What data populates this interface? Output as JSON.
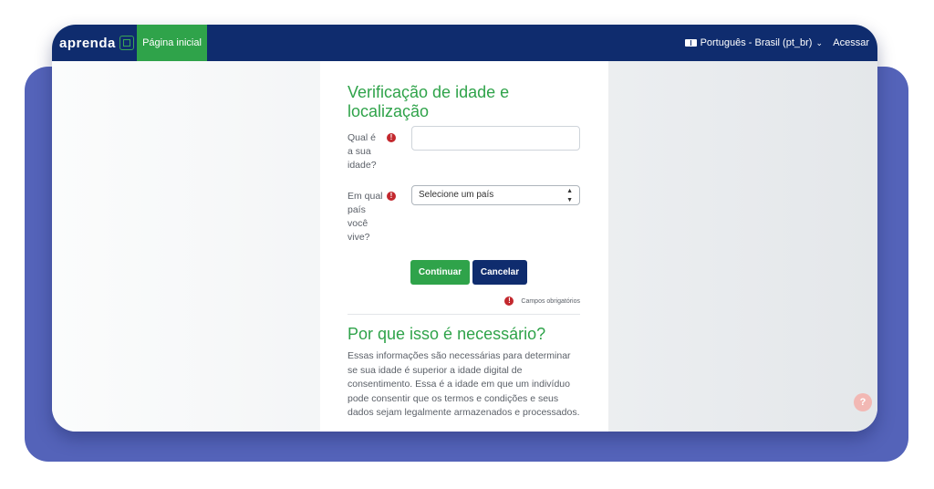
{
  "topbar": {
    "logo_text": "aprenda",
    "home_tab": "Página inicial",
    "language": "Português - Brasil (pt_br)",
    "login": "Acessar",
    "colors": {
      "bar": "#0f2c6e",
      "accent": "#2fa34a"
    }
  },
  "form": {
    "title": "Verificação de idade e localização",
    "age_label_lines": [
      "Qual é",
      "a sua",
      "idade?"
    ],
    "age_value": "",
    "country_label_lines": [
      "Em qual",
      "país",
      "você",
      "vive?"
    ],
    "country_select_value": "Selecione um país",
    "continue_button": "Continuar",
    "cancel_button": "Cancelar",
    "required_icon": "!",
    "required_note": "Campos obrigatórios"
  },
  "info": {
    "heading": "Por que isso é necessário?",
    "text": "Essas informações são necessárias para determinar se sua idade é superior a idade digital de consentimento. Essa é a idade em que um indivíduo pode consentir que os termos e condições e seus dados sejam legalmente armazenados e processados."
  },
  "help_button": "?"
}
